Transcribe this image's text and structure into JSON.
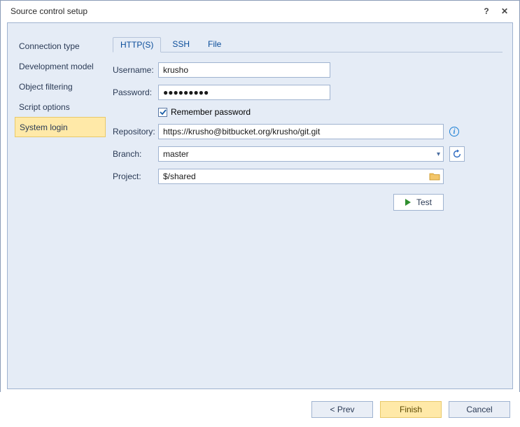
{
  "dialog": {
    "title": "Source control setup"
  },
  "sidebar": {
    "items": [
      {
        "label": "Connection type"
      },
      {
        "label": "Development model"
      },
      {
        "label": "Object filtering"
      },
      {
        "label": "Script options"
      },
      {
        "label": "System login"
      }
    ],
    "active_index": 4
  },
  "tabs": {
    "items": [
      {
        "label": "HTTP(S)"
      },
      {
        "label": "SSH"
      },
      {
        "label": "File"
      }
    ],
    "active_index": 0
  },
  "form": {
    "username_label": "Username:",
    "username_value": "krusho",
    "password_label": "Password:",
    "password_value": "●●●●●●●●●",
    "remember_label": "Remember password",
    "remember_checked": true,
    "repository_label": "Repository:",
    "repository_value": "https://krusho@bitbucket.org/krusho/git.git",
    "branch_label": "Branch:",
    "branch_value": "master",
    "project_label": "Project:",
    "project_value": "$/shared",
    "test_label": "Test"
  },
  "footer": {
    "prev_label": "< Prev",
    "finish_label": "Finish",
    "cancel_label": "Cancel"
  }
}
